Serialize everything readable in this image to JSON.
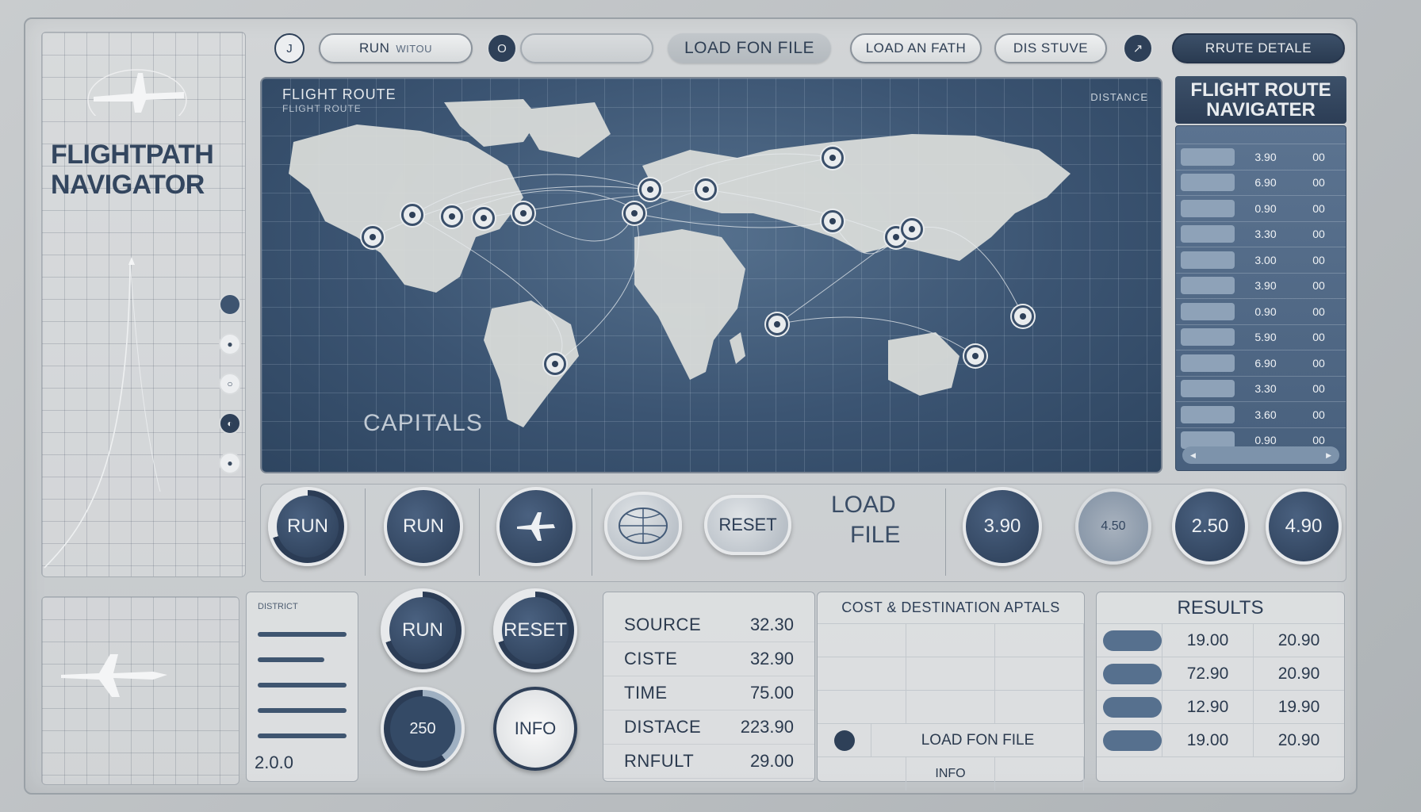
{
  "brand": {
    "line1": "FLIGHTPATH",
    "line2": "NAVIGATOR",
    "tagline": ""
  },
  "toolbar": {
    "first_icon": "J",
    "run_label": "RUN",
    "run_sub": "WITOU",
    "info_icon": "O",
    "info_text": "",
    "load_from_file": "LOAD FON FILE",
    "load_path": "LOAD AN FATH",
    "distance": "DIS STUVE",
    "arrow_icon": "↗",
    "route_details": "RRUTE DETALE"
  },
  "map": {
    "title": "FLIGHT ROUTE",
    "subtitle": "FLIGHT ROUTE",
    "distance_label": "DISTANCE",
    "capitals_label": "CAPITALS"
  },
  "route_panel": {
    "title_line1": "FLIGHT ROUTE",
    "title_line2": "NAVIGATER",
    "rows": [
      {
        "c2": "3.90",
        "c3": "00"
      },
      {
        "c2": "6.90",
        "c3": "00"
      },
      {
        "c2": "0.90",
        "c3": "00"
      },
      {
        "c2": "3.30",
        "c3": "00"
      },
      {
        "c2": "3.00",
        "c3": "00"
      },
      {
        "c2": "3.90",
        "c3": "00"
      },
      {
        "c2": "0.90",
        "c3": "00"
      },
      {
        "c2": "5.90",
        "c3": "00"
      },
      {
        "c2": "6.90",
        "c3": "00"
      },
      {
        "c2": "3.30",
        "c3": "00"
      },
      {
        "c2": "3.60",
        "c3": "00"
      },
      {
        "c2": "0.90",
        "c3": "00"
      }
    ]
  },
  "controls": {
    "run1": "RUN",
    "run2": "RUN",
    "reset": "RESET",
    "load": "LOAD",
    "file": "FILE",
    "g1": "3.90",
    "g2": "4.50",
    "g3": "2.50",
    "g4": "4.90"
  },
  "bottom": {
    "left_header": "DISTRICT",
    "left_value": "2.0.0",
    "run": "RUN",
    "reset": "RESET",
    "stat": "250",
    "info": "INFO",
    "kv": [
      {
        "k": "SOURCE",
        "v": "32.30"
      },
      {
        "k": "CISTE",
        "v": "32.90"
      },
      {
        "k": "TIME",
        "v": "75.00"
      },
      {
        "k": "DISTACE",
        "v": "223.90"
      },
      {
        "k": "RNFULT",
        "v": "29.00"
      }
    ],
    "cost_title": "COST & DESTINATION APTALS",
    "cost_load": "LOAD FON FILE",
    "cost_info": "INFO",
    "results_title": "RESULTS",
    "results": [
      {
        "a": "19.00",
        "b": "20.90"
      },
      {
        "a": "72.90",
        "b": "20.90"
      },
      {
        "a": "12.90",
        "b": "19.90"
      },
      {
        "a": "19.00",
        "b": "20.90"
      }
    ]
  }
}
